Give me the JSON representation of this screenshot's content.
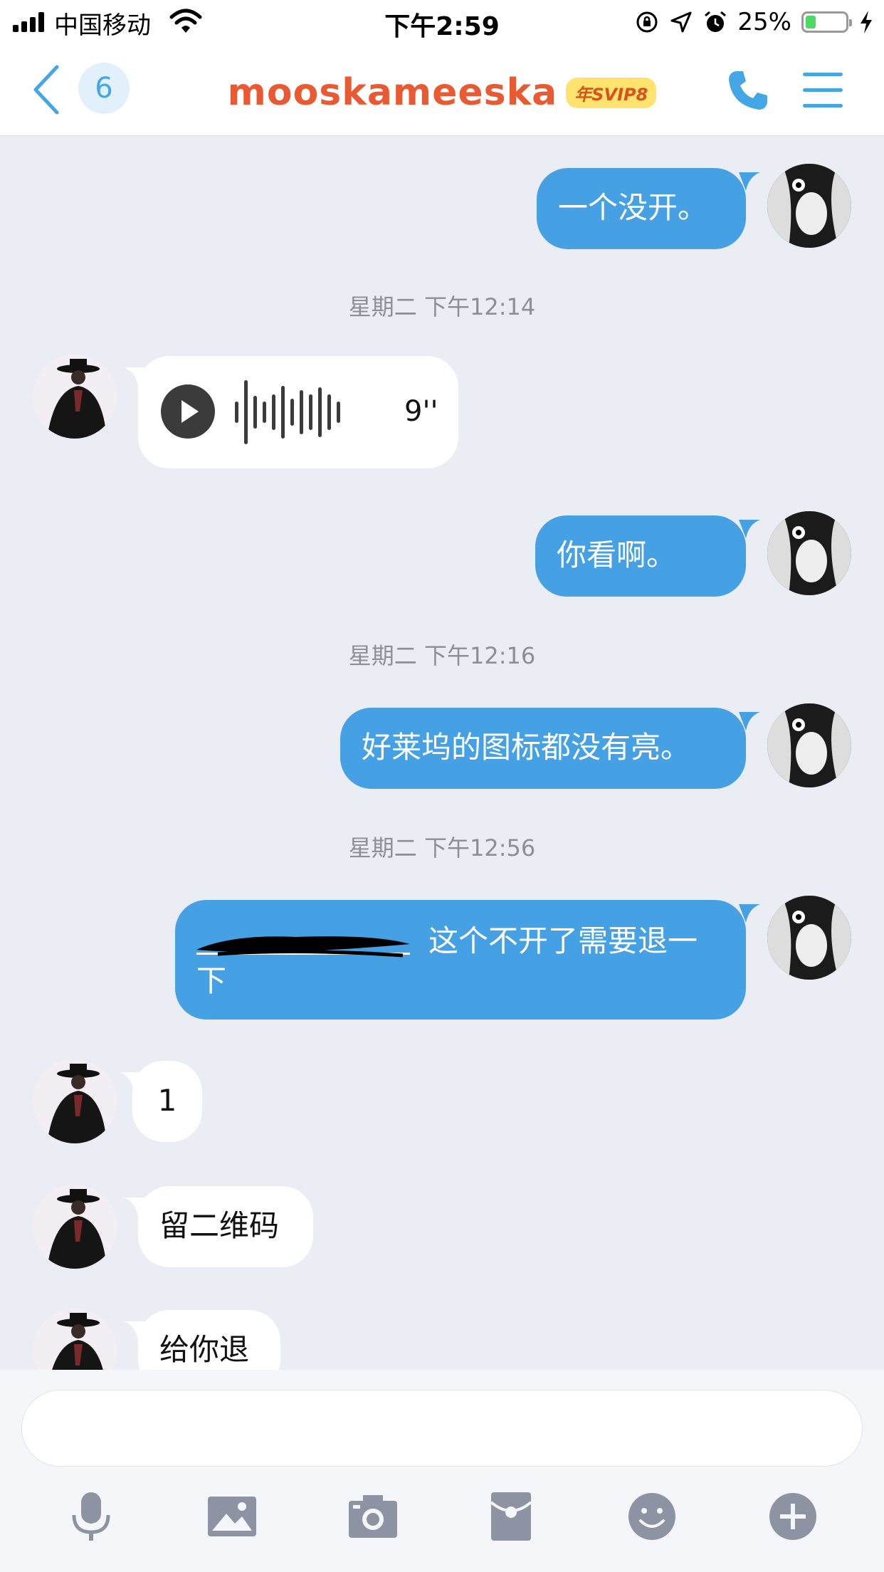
{
  "status_bar": {
    "carrier": "中国移动",
    "time": "下午2:59",
    "battery_percent": "25%",
    "battery_level": 0.25
  },
  "nav": {
    "unread_count": "6",
    "title": "mooskameeska",
    "vip_badge": "年SVIP8"
  },
  "messages": [
    {
      "from": "me",
      "text": "一个没开。"
    },
    {
      "type": "timestamp",
      "text": "星期二 下午12:14"
    },
    {
      "from": "other",
      "type": "voice",
      "duration": "9''"
    },
    {
      "from": "me",
      "text": "你看啊。"
    },
    {
      "type": "timestamp",
      "text": "星期二 下午12:16"
    },
    {
      "from": "me",
      "text": "好莱坞的图标都没有亮。"
    },
    {
      "type": "timestamp",
      "text": "星期二 下午12:56"
    },
    {
      "from": "me",
      "line1": "这个不开了需要退一",
      "line2": "下"
    },
    {
      "from": "other",
      "text": "1"
    },
    {
      "from": "other",
      "text": "留二维码"
    },
    {
      "from": "other",
      "text": "给你退"
    }
  ],
  "colors": {
    "accent": "#45a6e6",
    "outgoing_bubble": "#45a0e4",
    "title": "#ea5a32",
    "background": "#ebedf5"
  },
  "toolbar_icons": [
    "microphone-icon",
    "image-icon",
    "camera-icon",
    "red-packet-icon",
    "emoji-icon",
    "plus-icon"
  ]
}
